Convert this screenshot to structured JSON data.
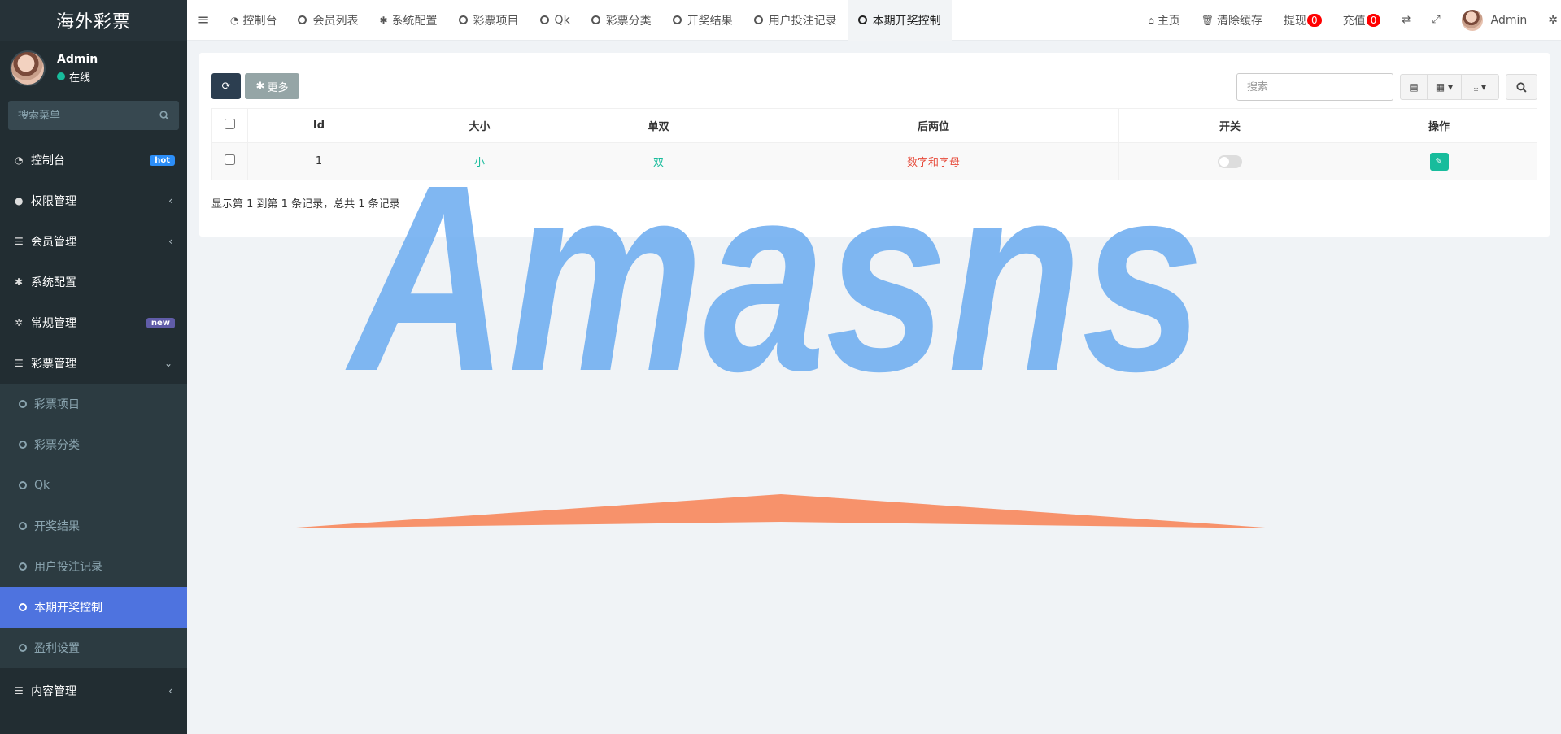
{
  "sidebar": {
    "logo": "海外彩票",
    "user": {
      "name": "Admin",
      "status": "在线"
    },
    "search_placeholder": "搜索菜单",
    "menu": [
      {
        "label": "控制台",
        "badge": "hot"
      },
      {
        "label": "权限管理"
      },
      {
        "label": "会员管理"
      },
      {
        "label": "系统配置"
      },
      {
        "label": "常规管理",
        "badge": "new"
      },
      {
        "label": "彩票管理"
      }
    ],
    "submenu": [
      "彩票项目",
      "彩票分类",
      "Qk",
      "开奖结果",
      "用户投注记录",
      "本期开奖控制",
      "盈利设置"
    ],
    "menu_bottom": {
      "label": "内容管理"
    }
  },
  "topbar": {
    "tabs": [
      "控制台",
      "会员列表",
      "系统配置",
      "彩票项目",
      "Qk",
      "彩票分类",
      "开奖结果",
      "用户投注记录",
      "本期开奖控制"
    ],
    "home": "主页",
    "clear_cache": "清除缓存",
    "withdraw": "提现",
    "withdraw_count": "0",
    "recharge": "充值",
    "recharge_count": "0",
    "user": "Admin"
  },
  "panel": {
    "more_label": "更多",
    "search_placeholder": "搜索",
    "columns": [
      "Id",
      "大小",
      "单双",
      "后两位",
      "开关",
      "操作"
    ],
    "rows": [
      {
        "id": "1",
        "size": "小",
        "parity": "双",
        "last_two": "数字和字母",
        "switch_on": false
      }
    ],
    "pagination_text": "显示第 1 到第 1 条记录，总共 1 条记录"
  },
  "watermark": {
    "text": "Amasns"
  }
}
